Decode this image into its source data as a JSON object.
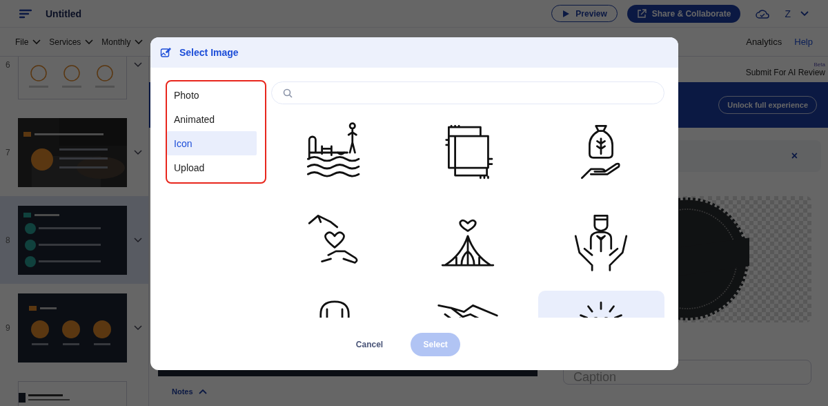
{
  "app": {
    "doc_title": "Untitled",
    "preview": "Preview",
    "share": "Share & Collaborate",
    "user_initial": "Z"
  },
  "menu": [
    {
      "label": "File"
    },
    {
      "label": "Services"
    },
    {
      "label": "Monthly"
    }
  ],
  "menu_right": [
    {
      "label": "Analytics",
      "kind": "plain"
    },
    {
      "label": "Help",
      "kind": "link"
    }
  ],
  "slides": [
    {
      "number": "6",
      "kind": "icons",
      "selected": false
    },
    {
      "number": "7",
      "kind": "photo",
      "selected": false
    },
    {
      "number": "8",
      "kind": "list",
      "selected": true
    },
    {
      "number": "9",
      "kind": "features",
      "selected": false
    },
    {
      "kind": "cover",
      "selected": false
    }
  ],
  "ai_review": {
    "badge": "Beta",
    "label": "Submit For AI Review"
  },
  "banner": {
    "button": "Unlock full experience"
  },
  "panel": {
    "close": "×",
    "caption_placeholder": "Caption"
  },
  "notes": "Notes",
  "dialog": {
    "title": "Select Image",
    "categories_highlighted": true,
    "categories": [
      {
        "label": "Photo",
        "selected": false
      },
      {
        "label": "Animated",
        "selected": false
      },
      {
        "label": "Icon",
        "selected": true
      },
      {
        "label": "Upload",
        "selected": false
      }
    ],
    "icons": [
      {
        "kind": "pool",
        "selected": false
      },
      {
        "kind": "hands-square",
        "selected": false
      },
      {
        "kind": "bag-hand",
        "selected": false
      },
      {
        "kind": "heart-hand",
        "selected": false
      },
      {
        "kind": "heart-tent",
        "selected": false
      },
      {
        "kind": "person-hands",
        "selected": false
      },
      {
        "kind": "person",
        "selected": false
      },
      {
        "kind": "handshake",
        "selected": false
      },
      {
        "kind": "heart-rays",
        "selected": true
      }
    ],
    "cancel": "Cancel",
    "select": {
      "label": "Select",
      "disabled": true
    }
  }
}
